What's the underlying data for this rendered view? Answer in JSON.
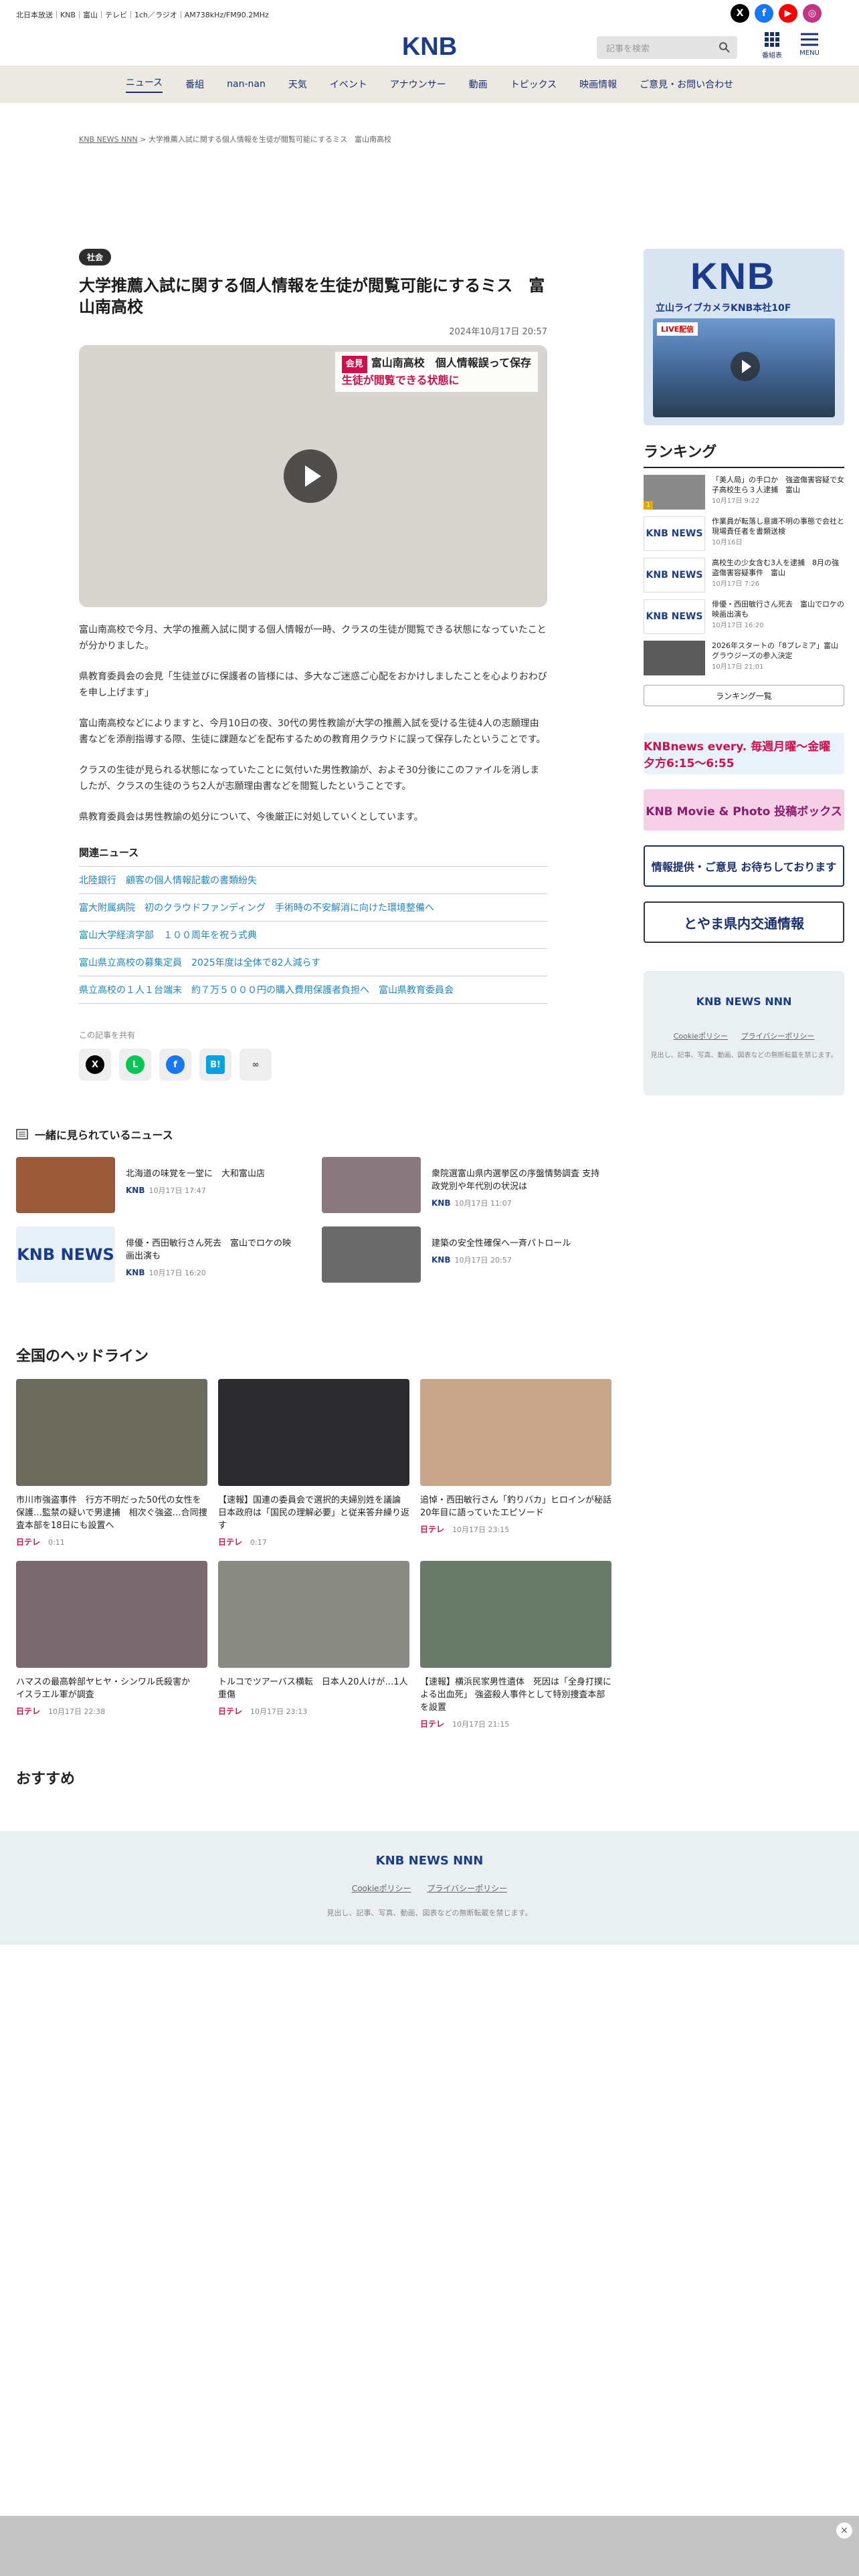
{
  "topbar": {
    "text": "北日本放送｜KNB｜富山｜テレビ｜1ch／ラジオ｜AM738kHz/FM90.2MHz"
  },
  "header": {
    "logo": "KNB",
    "search_placeholder": "記事を検索",
    "program_label": "番組表",
    "menu_label": "MENU",
    "social": [
      "X",
      "f",
      "▶",
      "◎"
    ]
  },
  "nav": [
    "ニュース",
    "番組",
    "nan-nan",
    "天気",
    "イベント",
    "アナウンサー",
    "動画",
    "トピックス",
    "映画情報",
    "ご意見・お問い合わせ"
  ],
  "breadcrumb": {
    "home": "KNB NEWS NNN",
    "sep": ">",
    "current": "大学推薦入試に関する個人情報を生徒が閲覧可能にするミス　富山南高校"
  },
  "article": {
    "tag": "社会",
    "title": "大学推薦入試に関する個人情報を生徒が閲覧可能にするミス　富山南高校",
    "date": "2024年10月17日 20:57",
    "video_caption_badge": "会見",
    "video_caption_line1": "富山南高校　個人情報誤って保存",
    "video_caption_line2": "生徒が閲覧できる状態に",
    "paragraphs": [
      "富山南高校で今月、大学の推薦入試に関する個人情報が一時、クラスの生徒が閲覧できる状態になっていたことが分かりました。",
      "県教育委員会の会見「生徒並びに保護者の皆様には、多大なご迷惑ご心配をおかけしましたことを心よりおわびを申し上げます」",
      "富山南高校などによりますと、今月10日の夜、30代の男性教諭が大学の推薦入試を受ける生徒4人の志願理由書などを添削指導する際、生徒に課題などを配布するための教育用クラウドに誤って保存したということです。",
      "クラスの生徒が見られる状態になっていたことに気付いた男性教諭が、およそ30分後にこのファイルを消しましたが、クラスの生徒のうち2人が志願理由書などを閲覧したということです。",
      "県教育委員会は男性教諭の処分について、今後厳正に対処していくとしています。"
    ],
    "related_heading": "関連ニュース",
    "related": [
      "北陸銀行　顧客の個人情報記載の書類紛失",
      "富大附属病院　初のクラウドファンディング　手術時の不安解消に向けた環境整備へ",
      "富山大学経済学部　１００周年を祝う式典",
      "富山県立高校の募集定員　2025年度は全体で82人減らす",
      "県立高校の１人１台端末　約７万５０００円の購入費用保護者負担へ　富山県教育委員会"
    ],
    "share_heading": "この記事を共有",
    "share_icons": [
      "X",
      "L",
      "f",
      "B!",
      "∞"
    ]
  },
  "sidebar": {
    "ad_logo": "KNB",
    "ad_text": "立山ライブカメラKNB本社10F",
    "ad_live": "LIVE配信",
    "ranking_title": "ランキング",
    "ranking": [
      {
        "title": "「美人局」の手口か　強盗傷害容疑で女子高校生ら３人逮捕　富山",
        "date": "10月17日 9:22",
        "thumb": "photo"
      },
      {
        "title": "作業員が転落し意識不明の事態で会社と現場責任者を書類送検",
        "date": "10月16日",
        "thumb": "KNB NEWS"
      },
      {
        "title": "高校生の少女含む3人を逮捕　8月の強盗傷害容疑事件　富山",
        "date": "10月17日 7:26",
        "thumb": "KNB NEWS"
      },
      {
        "title": "俳優・西田敏行さん死去　富山でロケの映画出演も",
        "date": "10月17日 16:20",
        "thumb": "KNB NEWS"
      },
      {
        "title": "2026年スタートの「8プレミア」富山グラウジーズの参入決定",
        "date": "10月17日 21:01",
        "thumb": "photo"
      }
    ],
    "ranking_button": "ランキング一覧",
    "banner1": "KNBnews every. 毎週月曜～金曜 夕方6:15～6:55",
    "banner2": "KNB Movie & Photo 投稿ボックス",
    "banner3": "情報提供・ご意見 お待ちしております",
    "banner4": "とやま県内交通情報",
    "footer_logo": "KNB NEWS NNN",
    "footer_links": [
      "Cookieポリシー",
      "プライバシーポリシー"
    ],
    "footer_copy": "見出し、記事、写真、動画、図表などの無断転載を禁じます。"
  },
  "together": {
    "heading": "一緒に見られているニュース",
    "items": [
      {
        "title": "北海道の味覚を一堂に　大和富山店",
        "source": "KNB",
        "date": "10月17日 17:47",
        "thumb": "photo"
      },
      {
        "title": "衆院選富山県内選挙区の序盤情勢調査 支持政党別や年代別の状況は",
        "source": "KNB",
        "date": "10月17日 11:07",
        "thumb": "photo"
      },
      {
        "title": "俳優・西田敏行さん死去　富山でロケの映画出演も",
        "source": "KNB",
        "date": "10月17日 16:20",
        "thumb": "KNB NEWS"
      },
      {
        "title": "建築の安全性確保へ一斉パトロール",
        "source": "KNB",
        "date": "10月17日 20:57",
        "thumb": "photo"
      }
    ]
  },
  "national": {
    "heading": "全国のヘッドライン",
    "items": [
      {
        "title": "市川市強盗事件　行方不明だった50代の女性を保護…監禁の疑いで男逮捕　相次ぐ強盗…合同捜査本部を18日にも設置へ",
        "source": "日テレ",
        "date": "0:11"
      },
      {
        "title": "【速報】国連の委員会で選択的夫婦別姓を議論　日本政府は「国民の理解必要」と従来答弁繰り返す",
        "source": "日テレ",
        "date": "0:17"
      },
      {
        "title": "追悼・西田敏行さん「釣りバカ」ヒロインが秘話　20年目に語っていたエピソード",
        "source": "日テレ",
        "date": "10月17日 23:15"
      },
      {
        "title": "ハマスの最高幹部ヤヒヤ・シンワル氏殺害か　イスラエル軍が調査",
        "source": "日テレ",
        "date": "10月17日 22:38"
      },
      {
        "title": "トルコでツアーバス横転　日本人20人けが…1人重傷",
        "source": "日テレ",
        "date": "10月17日 23:13"
      },
      {
        "title": "【速報】横浜民家男性遺体　死因は「全身打撲による出血死」 強盗殺人事件として特別捜査本部を設置",
        "source": "日テレ",
        "date": "10月17日 21:15"
      }
    ]
  },
  "recommend_heading": "おすすめ",
  "footer": {
    "logo": "KNB NEWS NNN",
    "links": [
      "Cookieポリシー",
      "プライバシーポリシー"
    ],
    "copy": "見出し、記事、写真、動画、図表などの無断転載を禁じます。"
  },
  "close_label": "×",
  "colors": {
    "brand": "#1a3c8b",
    "link": "#1d87c4",
    "ntv": "#d0104c",
    "nav_bg": "#ece9e3"
  }
}
